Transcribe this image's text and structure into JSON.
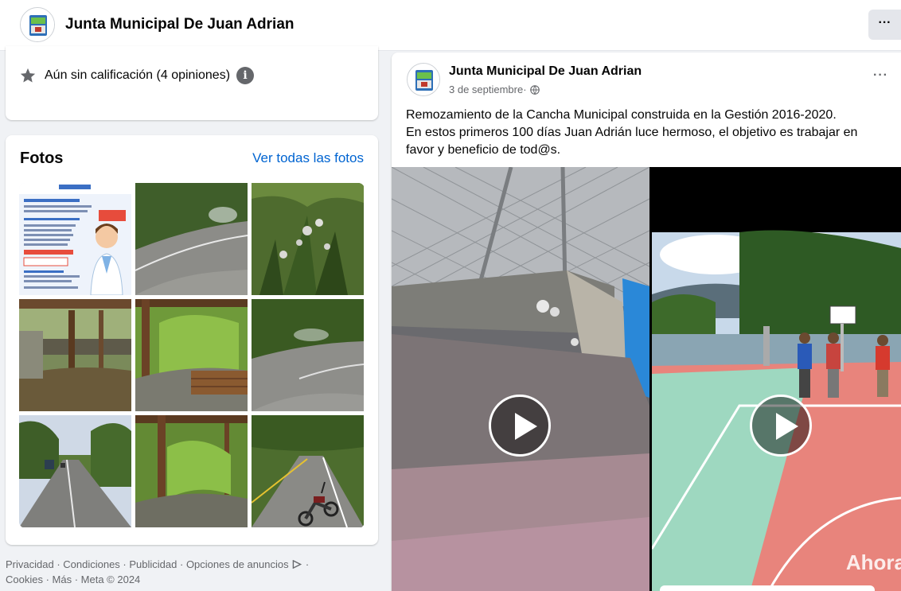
{
  "header": {
    "page_name": "Junta Municipal De Juan Adrian",
    "more_label": "···"
  },
  "rating": {
    "text": "Aún sin calificación (4 opiniones)",
    "info_label": "i"
  },
  "photos": {
    "title": "Fotos",
    "see_all": "Ver todas las fotos",
    "items": [
      {
        "id": "p1",
        "desc": "flyer"
      },
      {
        "id": "p2",
        "desc": "road"
      },
      {
        "id": "p3",
        "desc": "vegetation"
      },
      {
        "id": "p4",
        "desc": "shelter"
      },
      {
        "id": "p5",
        "desc": "garden"
      },
      {
        "id": "p6",
        "desc": "road"
      },
      {
        "id": "p7",
        "desc": "road-truck"
      },
      {
        "id": "p8",
        "desc": "garden"
      },
      {
        "id": "p9",
        "desc": "road-motorcycle"
      }
    ]
  },
  "footer": {
    "links": [
      "Privacidad",
      "Condiciones",
      "Publicidad",
      "Opciones de anuncios"
    ],
    "links2": [
      "Cookies",
      "Más"
    ],
    "copyright": "Meta © 2024",
    "separator": " · "
  },
  "post": {
    "author": "Junta Municipal De Juan Adrian",
    "date": "3 de septiembre",
    "date_sep": " · ",
    "more_label": "···",
    "text_lines": [
      "Remozamiento de la Cancha Municipal construida en la Gestión 2016-2020.",
      "En estos primeros 100 días Juan Adrián luce hermoso, el objetivo es trabajar en favor y beneficio de tod@s."
    ],
    "videos": [
      {
        "id": "v1"
      },
      {
        "id": "v2",
        "overlay": "Ahora"
      }
    ]
  },
  "colors": {
    "link": "#0064d1",
    "secondary_text": "#65676b",
    "background": "#f0f2f5",
    "court_red": "#e8847c",
    "court_green": "#9ed8c0"
  }
}
